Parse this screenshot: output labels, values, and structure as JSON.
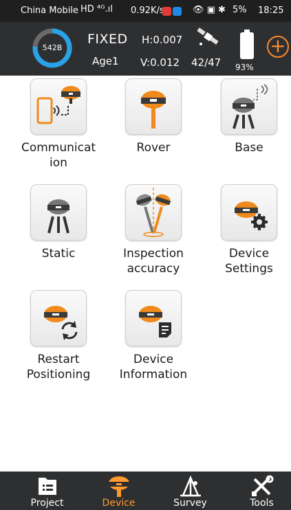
{
  "status_bar": {
    "carrier": "China Mobile",
    "signal": "HD ⁴ᴳ.ıl",
    "speed": "0.92K/s",
    "battery": "5%",
    "time": "18:25"
  },
  "header": {
    "storage_label": "542B",
    "fix_status": "FIXED",
    "age": "Age1",
    "h_precision": "H:0.007",
    "v_precision": "V:0.012",
    "satellites": "42/47",
    "battery_pct": "93%",
    "add_symbol": "+"
  },
  "tiles": [
    {
      "label": "Communication",
      "icon": "communication-icon"
    },
    {
      "label": "Rover",
      "icon": "rover-icon"
    },
    {
      "label": "Base",
      "icon": "base-icon"
    },
    {
      "label": "Static",
      "icon": "static-icon"
    },
    {
      "label": "Inspection accuracy",
      "icon": "inspection-accuracy-icon"
    },
    {
      "label": "Device Settings",
      "icon": "device-settings-icon"
    },
    {
      "label": "Restart Positioning",
      "icon": "restart-positioning-icon"
    },
    {
      "label": "Device Information",
      "icon": "device-information-icon"
    }
  ],
  "bottom_nav": [
    {
      "label": "Project",
      "icon": "project-icon",
      "active": false
    },
    {
      "label": "Device",
      "icon": "device-icon",
      "active": true
    },
    {
      "label": "Survey",
      "icon": "survey-icon",
      "active": false
    },
    {
      "label": "Tools",
      "icon": "tools-icon",
      "active": false
    }
  ],
  "colors": {
    "accent": "#ff9a2e",
    "header_bg": "#2e2f31",
    "ring": "#29a3e8"
  }
}
